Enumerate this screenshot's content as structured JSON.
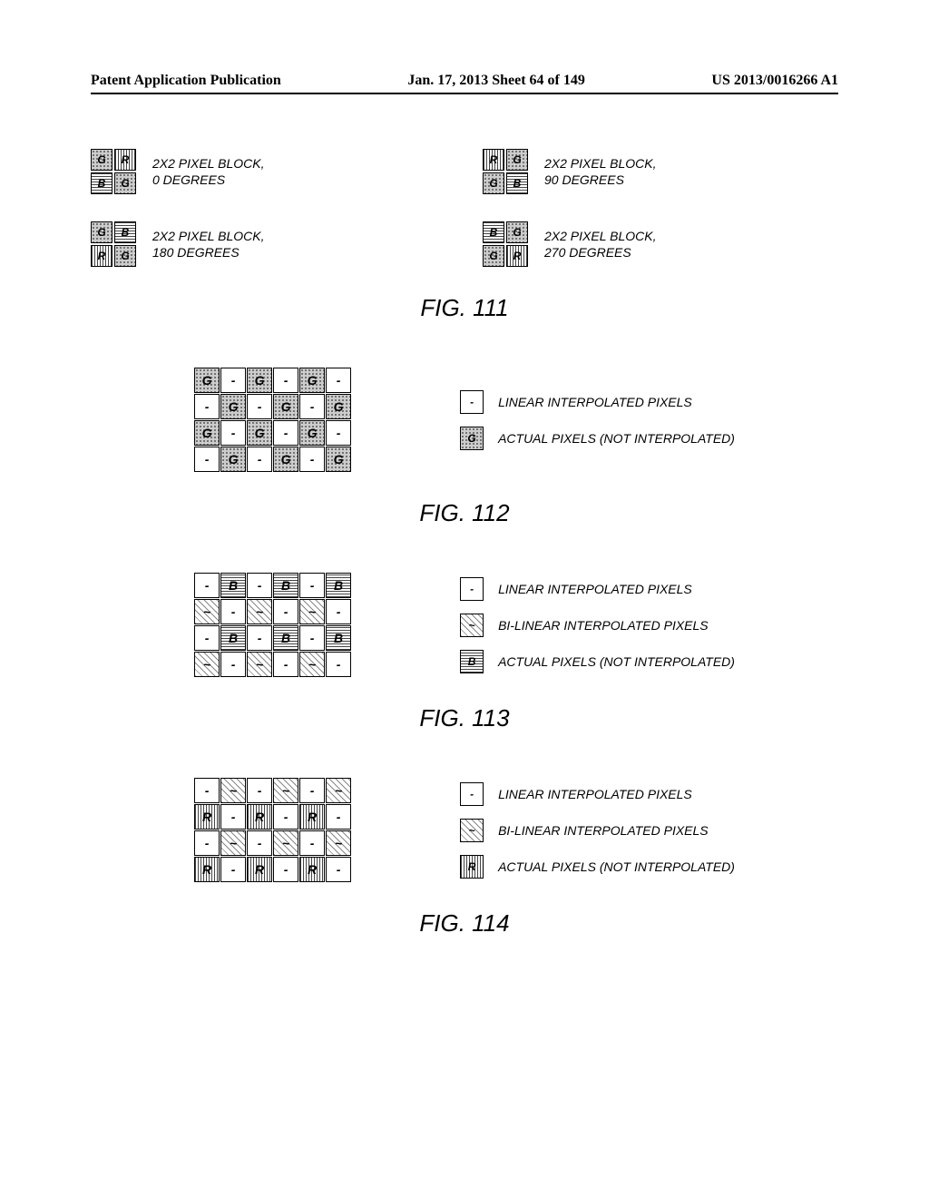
{
  "header": {
    "left": "Patent Application Publication",
    "center": "Jan. 17, 2013  Sheet 64 of 149",
    "right": "US 2013/0016266 A1"
  },
  "fig111": {
    "caption": "FIG. 111",
    "blocks": [
      {
        "cells": [
          "G",
          "R",
          "B",
          "G"
        ],
        "patterns": [
          "dot",
          "vert",
          "horiz",
          "dot"
        ],
        "label_l1": "2X2 PIXEL BLOCK,",
        "label_l2": "0 DEGREES"
      },
      {
        "cells": [
          "R",
          "G",
          "G",
          "B"
        ],
        "patterns": [
          "vert",
          "dot",
          "dot",
          "horiz"
        ],
        "label_l1": "2X2 PIXEL BLOCK,",
        "label_l2": "90 DEGREES"
      },
      {
        "cells": [
          "G",
          "B",
          "R",
          "G"
        ],
        "patterns": [
          "dot",
          "horiz",
          "vert",
          "dot"
        ],
        "label_l1": "2X2 PIXEL BLOCK,",
        "label_l2": "180 DEGREES"
      },
      {
        "cells": [
          "B",
          "G",
          "G",
          "R"
        ],
        "patterns": [
          "horiz",
          "dot",
          "dot",
          "vert"
        ],
        "label_l1": "2X2 PIXEL BLOCK,",
        "label_l2": "270 DEGREES"
      }
    ]
  },
  "fig112": {
    "caption": "FIG. 112",
    "grid": [
      [
        "G",
        "-",
        "G",
        "-",
        "G",
        "-"
      ],
      [
        "-",
        "G",
        "-",
        "G",
        "-",
        "G"
      ],
      [
        "G",
        "-",
        "G",
        "-",
        "G",
        "-"
      ],
      [
        "-",
        "G",
        "-",
        "G",
        "-",
        "G"
      ]
    ],
    "legend": [
      {
        "key": "-",
        "pattern": "plain",
        "label": "LINEAR INTERPOLATED PIXELS"
      },
      {
        "key": "G",
        "pattern": "dot",
        "label": "ACTUAL PIXELS (NOT INTERPOLATED)"
      }
    ]
  },
  "fig113": {
    "caption": "FIG. 113",
    "grid": [
      [
        "-",
        "B",
        "-",
        "B",
        "-",
        "B"
      ],
      [
        "~",
        "-",
        "~",
        "-",
        "~",
        "-"
      ],
      [
        "-",
        "B",
        "-",
        "B",
        "-",
        "B"
      ],
      [
        "~",
        "-",
        "~",
        "-",
        "~",
        "-"
      ]
    ],
    "legend": [
      {
        "key": "-",
        "pattern": "plain",
        "label": "LINEAR INTERPOLATED PIXELS"
      },
      {
        "key": "~",
        "pattern": "diag",
        "label": "BI-LINEAR INTERPOLATED PIXELS"
      },
      {
        "key": "B",
        "pattern": "horiz",
        "label": "ACTUAL PIXELS (NOT INTERPOLATED)"
      }
    ]
  },
  "fig114": {
    "caption": "FIG. 114",
    "grid": [
      [
        "-",
        "~",
        "-",
        "~",
        "-",
        "~"
      ],
      [
        "R",
        "-",
        "R",
        "-",
        "R",
        "-"
      ],
      [
        "-",
        "~",
        "-",
        "~",
        "-",
        "~"
      ],
      [
        "R",
        "-",
        "R",
        "-",
        "R",
        "-"
      ]
    ],
    "legend": [
      {
        "key": "-",
        "pattern": "plain",
        "label": "LINEAR INTERPOLATED PIXELS"
      },
      {
        "key": "~",
        "pattern": "diag",
        "label": "BI-LINEAR INTERPOLATED PIXELS"
      },
      {
        "key": "R",
        "pattern": "vert",
        "label": "ACTUAL PIXELS (NOT INTERPOLATED)"
      }
    ]
  }
}
